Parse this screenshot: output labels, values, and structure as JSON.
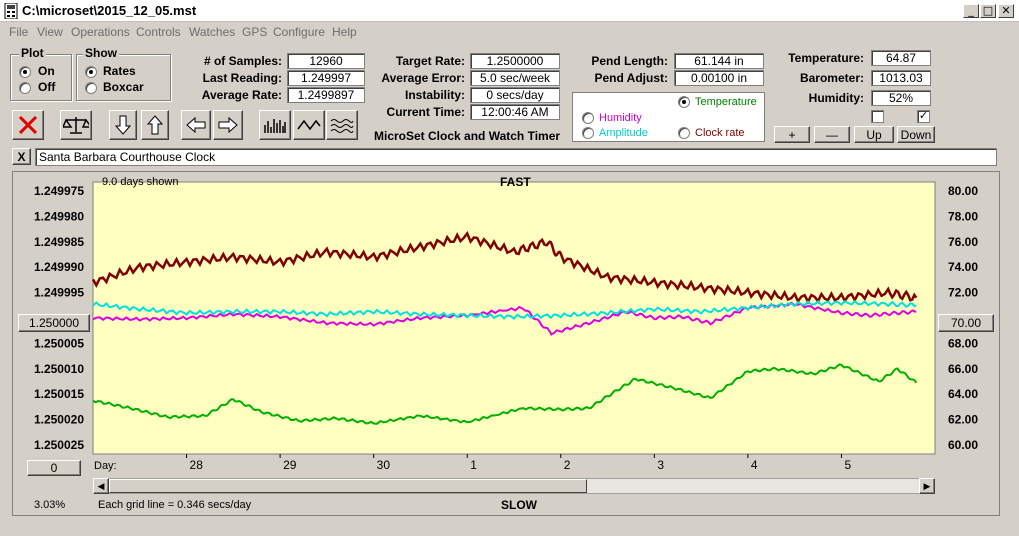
{
  "window": {
    "title": "C:\\microset\\2015_12_05.mst",
    "min_glyph": "_",
    "max_glyph": "□",
    "close_glyph": "✕"
  },
  "menu": [
    "File",
    "View",
    "Operations",
    "Controls",
    "Watches",
    "GPS",
    "Configure",
    "Help"
  ],
  "plot": {
    "title": "Plot",
    "on_label": "On",
    "off_label": "Off",
    "selected": "On"
  },
  "show": {
    "title": "Show",
    "rates_label": "Rates",
    "boxcar_label": "Boxcar",
    "selected": "Rates"
  },
  "stats": {
    "samples_label": "# of Samples:",
    "samples_value": "12960",
    "last_label": "Last Reading:",
    "last_value": "1.249997",
    "avg_label": "Average Rate:",
    "avg_value": "1.2499897"
  },
  "rates": {
    "target_label": "Target Rate:",
    "target_value": "1.2500000",
    "avgerr_label": "Average Error:",
    "avgerr_value": "5.0 sec/week",
    "instab_label": "Instability:",
    "instab_value": "0 secs/day",
    "time_label": "Current Time:",
    "time_value": "12:00:46 AM",
    "app_name": "MicroSet Clock and Watch Timer"
  },
  "pendulum": {
    "length_label": "Pend Length:",
    "length_value": "61.144 in",
    "adjust_label": "Pend Adjust:",
    "adjust_value": "0.00100 in"
  },
  "sensor_select": {
    "temperature_label": "Temperature",
    "humidity_label": "Humidity",
    "amplitude_label": "Amplitude",
    "clockrate_label": "Clock rate",
    "selected": "Temperature",
    "temperature_color": "#008000",
    "humidity_color": "#cc00cc",
    "amplitude_color": "#00cccc",
    "clockrate_color": "#800000"
  },
  "env": {
    "temp_label": "Temperature:",
    "temp_value": "64.87",
    "baro_label": "Barometer:",
    "baro_value": "1013.03",
    "hum_label": "Humidity:",
    "hum_value": "52%",
    "check1": false,
    "check2": true
  },
  "adjust_buttons": {
    "plus": "+",
    "minus": "—",
    "up": "Up",
    "down": "Down"
  },
  "toolbar_icons": [
    "close-x-icon",
    "balance-scale-icon",
    "arrow-down-icon",
    "arrow-up-icon",
    "arrow-left-icon",
    "arrow-right-icon",
    "histogram-icon",
    "wave-icon",
    "multi-wave-icon"
  ],
  "clock_name": "Santa Barbara Courthouse Clock",
  "clock_clear": "X",
  "chart": {
    "days_shown": "9.0 days shown",
    "fast_label": "FAST",
    "slow_label": "SLOW",
    "left_ref_value": "1.250000",
    "right_ref_value": "70.00",
    "bottom_left_value": "0",
    "percent": "3.03%",
    "grid_note": "Each grid line = 0.346 secs/day",
    "day_label": "Day:",
    "colors": {
      "background": "#ffffc0",
      "rate": "#800000",
      "temperature": "#00b000",
      "humidity": "#e000e0",
      "amplitude": "#00e0e0"
    }
  },
  "chart_data": {
    "type": "line",
    "title": "",
    "subtitle": "9.0 days shown",
    "xlabel": "Day:",
    "x_ticks": [
      "28",
      "29",
      "30",
      "1",
      "2",
      "3",
      "4",
      "5"
    ],
    "y_left_ticks": [
      "1.249975",
      "1.249980",
      "1.249985",
      "1.249990",
      "1.249995",
      "1.250000",
      "1.250005",
      "1.250010",
      "1.250015",
      "1.250020",
      "1.250025"
    ],
    "y_left_range": [
      1.249975,
      1.250025
    ],
    "y_right_ticks": [
      "80.00",
      "78.00",
      "76.00",
      "74.00",
      "72.00",
      "70.00",
      "68.00",
      "66.00",
      "64.00",
      "62.00",
      "60.00"
    ],
    "y_right_range": [
      60,
      80
    ],
    "grid": true,
    "x_range": [
      27.0,
      36.0
    ],
    "series": [
      {
        "axis": "left",
        "x": [
          27.0,
          27.5,
          28.0,
          28.5,
          29.0,
          29.5,
          30.0,
          30.5,
          31.0,
          31.5,
          31.85,
          32.0,
          32.5,
          33.0,
          33.5,
          34.0,
          34.5,
          35.0,
          35.5,
          35.8
        ],
        "values": [
          1.249993,
          1.24999,
          1.249989,
          1.249988,
          1.249989,
          1.249987,
          1.249988,
          1.249986,
          1.249984,
          1.249987,
          1.249985,
          1.249988,
          1.249992,
          1.249993,
          1.249994,
          1.249995,
          1.249996,
          1.249996,
          1.249995,
          1.249996
        ]
      },
      {
        "axis": "right",
        "x": [
          27.0,
          27.4,
          27.8,
          28.2,
          28.5,
          28.8,
          29.2,
          29.6,
          30.0,
          30.5,
          31.0,
          31.6,
          32.0,
          32.3,
          32.6,
          32.8,
          33.2,
          33.6,
          34.0,
          34.3,
          34.7,
          35.0,
          35.4,
          35.6,
          35.8
        ],
        "values": [
          63.5,
          62.9,
          62.2,
          62.3,
          63.6,
          62.6,
          61.9,
          62.1,
          61.7,
          62.3,
          61.8,
          62.9,
          62.8,
          62.9,
          64.3,
          65.2,
          64.5,
          63.7,
          65.8,
          66.0,
          65.6,
          66.3,
          65.0,
          66.0,
          64.9
        ]
      },
      {
        "axis": "right",
        "x": [
          27.0,
          27.5,
          28.0,
          28.5,
          29.0,
          29.5,
          30.0,
          30.5,
          31.0,
          31.6,
          31.9,
          32.3,
          32.7,
          33.0,
          33.3,
          33.6,
          34.0,
          34.5,
          35.0,
          35.3,
          35.6,
          35.8
        ],
        "values": [
          70.0,
          69.9,
          70.0,
          70.3,
          70.1,
          69.6,
          69.5,
          70.0,
          70.2,
          70.8,
          68.8,
          69.6,
          70.5,
          70.0,
          70.1,
          69.6,
          70.8,
          71.1,
          70.4,
          70.2,
          70.4,
          70.5
        ]
      },
      {
        "axis": "right",
        "x": [
          27.0,
          27.5,
          28.0,
          28.5,
          29.0,
          29.5,
          30.0,
          30.5,
          31.0,
          31.5,
          32.0,
          32.5,
          33.0,
          33.5,
          34.0,
          34.5,
          35.0,
          35.5,
          35.8
        ],
        "values": [
          71.1,
          70.7,
          70.4,
          70.5,
          70.5,
          70.3,
          70.5,
          70.3,
          70.2,
          70.1,
          70.2,
          70.4,
          70.7,
          70.5,
          70.8,
          71.1,
          71.2,
          71.1,
          71.0
        ]
      }
    ]
  }
}
